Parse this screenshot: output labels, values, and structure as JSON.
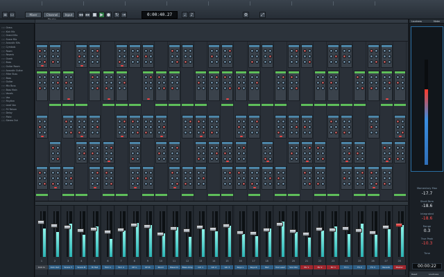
{
  "toolbar": {
    "buttons": [
      "Mixer",
      "Channel Racks",
      "Input"
    ],
    "time": "0:00:40.27"
  },
  "browser": {
    "items": [
      "Grass",
      "Kick Mic",
      "Grand Kits",
      "Snare Mix",
      "Acoustic Kits",
      "Cymbals",
      "Room",
      "Reverb",
      "Overh",
      "Buss",
      "Guitar Room",
      "Acoustic Guitar",
      "Filter Buss",
      "Bass",
      "Guitar",
      "Mix Buss",
      "Bass Main",
      "Vocals",
      "Vox",
      "Rhythm",
      "Lead Vox",
      "FX Return",
      "Delay",
      "Plate",
      "Stereo Out"
    ]
  },
  "mixer": {
    "channels": [
      {
        "num": "1",
        "name": "Kick In",
        "level": 0.62,
        "fader": 0.78,
        "style": "dark"
      },
      {
        "num": "2",
        "name": "Kick Out",
        "level": 0.55,
        "fader": 0.7,
        "style": "blue"
      },
      {
        "num": "3",
        "name": "Snare T",
        "level": 0.72,
        "fader": 0.66,
        "style": "blue"
      },
      {
        "num": "4",
        "name": "Snare B",
        "level": 0.48,
        "fader": 0.58,
        "style": "blue"
      },
      {
        "num": "5",
        "name": "Hi Hat",
        "level": 0.66,
        "fader": 0.62,
        "style": "blue"
      },
      {
        "num": "6",
        "name": "Tom 1",
        "level": 0.4,
        "fader": 0.55,
        "style": "blue"
      },
      {
        "num": "7",
        "name": "Tom 2",
        "level": 0.58,
        "fader": 0.6,
        "style": "blue"
      },
      {
        "num": "8",
        "name": "OH L",
        "level": 0.74,
        "fader": 0.72,
        "style": "blue"
      },
      {
        "num": "9",
        "name": "OH R",
        "level": 0.7,
        "fader": 0.68,
        "style": "blue"
      },
      {
        "num": "10",
        "name": "Room",
        "level": 0.52,
        "fader": 0.5,
        "style": "blue"
      },
      {
        "num": "11",
        "name": "Bass DI",
        "level": 0.65,
        "fader": 0.64,
        "style": "blue"
      },
      {
        "num": "12",
        "name": "Bass Amp",
        "level": 0.44,
        "fader": 0.58,
        "style": "blue"
      },
      {
        "num": "13",
        "name": "Gtr 1",
        "level": 0.6,
        "fader": 0.66,
        "style": "blue"
      },
      {
        "num": "14",
        "name": "Gtr 2",
        "level": 0.56,
        "fader": 0.62,
        "style": "blue"
      },
      {
        "num": "15",
        "name": "Gtr 3",
        "level": 0.68,
        "fader": 0.7,
        "style": "blue"
      },
      {
        "num": "16",
        "name": "Keys L",
        "level": 0.5,
        "fader": 0.54,
        "style": "blue"
      },
      {
        "num": "17",
        "name": "Keys R",
        "level": 0.46,
        "fader": 0.52,
        "style": "blue"
      },
      {
        "num": "18",
        "name": "Pad",
        "level": 0.62,
        "fader": 0.6,
        "style": "blue"
      },
      {
        "num": "19",
        "name": "Vox Lead",
        "level": 0.78,
        "fader": 0.74,
        "style": "blue"
      },
      {
        "num": "20",
        "name": "Vox Dbl",
        "level": 0.54,
        "fader": 0.56,
        "style": "blue"
      },
      {
        "num": "21",
        "name": "BV 1",
        "level": 0.42,
        "fader": 0.5,
        "style": "red"
      },
      {
        "num": "22",
        "name": "BV 2",
        "level": 0.58,
        "fader": 0.62,
        "style": "red"
      },
      {
        "num": "23",
        "name": "BV 3",
        "level": 0.66,
        "fader": 0.6,
        "style": "red"
      },
      {
        "num": "24",
        "name": "FX 1",
        "level": 0.5,
        "fader": 0.64,
        "style": "blue"
      },
      {
        "num": "25",
        "name": "FX 2",
        "level": 0.72,
        "fader": 0.58,
        "style": "blue"
      },
      {
        "num": "26",
        "name": "FX 3",
        "level": 0.48,
        "fader": 0.54,
        "style": "blue"
      },
      {
        "num": "27",
        "name": "Reverb",
        "level": 0.6,
        "fader": 0.66,
        "style": "blue"
      },
      {
        "num": "28",
        "name": "Master",
        "level": 0.7,
        "fader": 0.72,
        "style": "red"
      }
    ]
  },
  "loudness": {
    "tab_left": "Loudness",
    "tab_right": "Meter",
    "momentary_label": "Momentary Max",
    "momentary": "-17.7",
    "short_term_label": "Short-Term",
    "short_term": "-18.6",
    "integrated_label": "Integrated",
    "integrated": "-18.6",
    "range_label": "Range",
    "range": "0.3",
    "true_peak_label": "True Peak",
    "true_peak": "-10.3",
    "time_label": "Time",
    "time": "00:00:22",
    "level": 0.72,
    "bottom_left": "Reset",
    "bottom_right": "Loudness"
  }
}
